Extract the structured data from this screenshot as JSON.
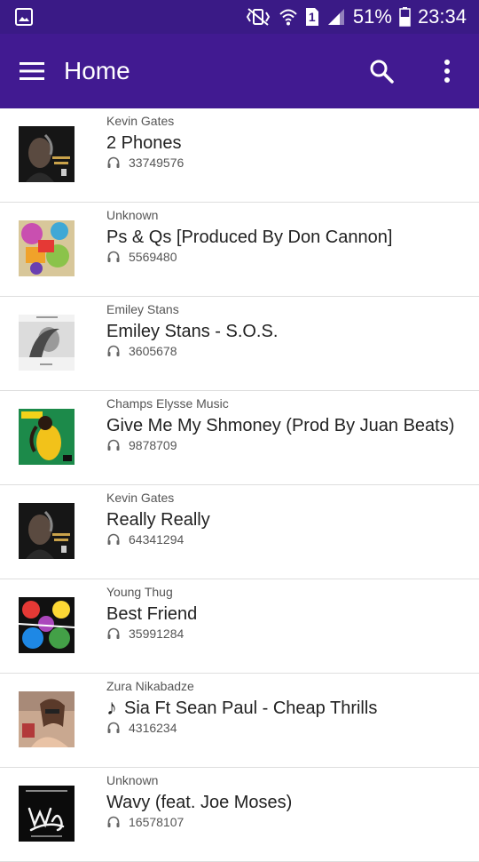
{
  "status_bar": {
    "battery_percent": "51%",
    "time": "23:34",
    "sim_slot": "1",
    "icons": [
      "gallery-icon",
      "mute-vibrate-icon",
      "wifi-icon",
      "sim-icon",
      "signal-icon",
      "battery-icon"
    ]
  },
  "app_bar": {
    "title": "Home",
    "colors": {
      "status": "#3a1a86",
      "bar": "#411a91"
    }
  },
  "tracks": [
    {
      "artist": "Kevin Gates",
      "title": "2 Phones",
      "plays": "33749576",
      "playing": false,
      "art": "kevin-gates"
    },
    {
      "artist": "Unknown",
      "title": "Ps & Qs [Produced By Don Cannon]",
      "plays": "5569480",
      "playing": false,
      "art": "colorful"
    },
    {
      "artist": "Emiley Stans",
      "title": "Emiley Stans - S.O.S.",
      "plays": "3605678",
      "playing": false,
      "art": "bw-portrait"
    },
    {
      "artist": "Champs Elysse Music",
      "title": "Give Me My Shmoney (Prod By Juan Beats)",
      "plays": "9878709",
      "playing": false,
      "art": "green-yellow"
    },
    {
      "artist": "Kevin Gates",
      "title": "Really Really",
      "plays": "64341294",
      "playing": false,
      "art": "kevin-gates"
    },
    {
      "artist": "Young Thug",
      "title": "Best Friend",
      "plays": "35991284",
      "playing": false,
      "art": "multicolor"
    },
    {
      "artist": "Zura Nikabadze",
      "title": "Sia Ft Sean Paul - Cheap Thrills",
      "plays": "4316234",
      "playing": true,
      "note": "♪",
      "art": "photo"
    },
    {
      "artist": "Unknown",
      "title": "Wavy (feat. Joe Moses)",
      "plays": "16578107",
      "playing": false,
      "art": "black-script"
    }
  ]
}
